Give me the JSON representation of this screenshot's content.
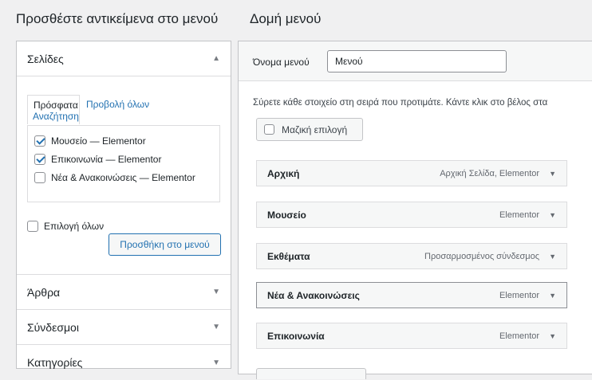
{
  "left_heading": "Προσθέστε αντικείμενα στο μενού",
  "right_heading": "Δομή μενού",
  "pages": {
    "title": "Σελίδες",
    "tabs": {
      "recent": "Πρόσφατα",
      "all": "Προβολή όλων",
      "search": "Αναζήτηση"
    },
    "items": [
      {
        "label": "Μουσείο — Elementor",
        "checked": true
      },
      {
        "label": "Επικοινωνία — Elementor",
        "checked": true
      },
      {
        "label": "Νέα & Ανακοινώσεις — Elementor",
        "checked": false
      }
    ],
    "select_all": "Επιλογή όλων",
    "add_button": "Προσθήκη στο μενού"
  },
  "accordion": [
    {
      "title": "Άρθρα"
    },
    {
      "title": "Σύνδεσμοι"
    },
    {
      "title": "Κατηγορίες"
    }
  ],
  "menu": {
    "name_label": "Όνομα μενού",
    "name_value": "Μενού",
    "hint": "Σύρετε κάθε στοιχείο στη σειρά που προτιμάτε. Κάντε κλικ στο βέλος στα",
    "bulk_label": "Μαζική επιλογή",
    "items": [
      {
        "title": "Αρχική",
        "type": "Αρχική Σελίδα, Elementor"
      },
      {
        "title": "Μουσείο",
        "type": "Elementor"
      },
      {
        "title": "Εκθέματα",
        "type": "Προσαρμοσμένος σύνδεσμος"
      },
      {
        "title": "Νέα & Ανακοινώσεις",
        "type": "Elementor"
      },
      {
        "title": "Επικοινωνία",
        "type": "Elementor"
      }
    ]
  }
}
